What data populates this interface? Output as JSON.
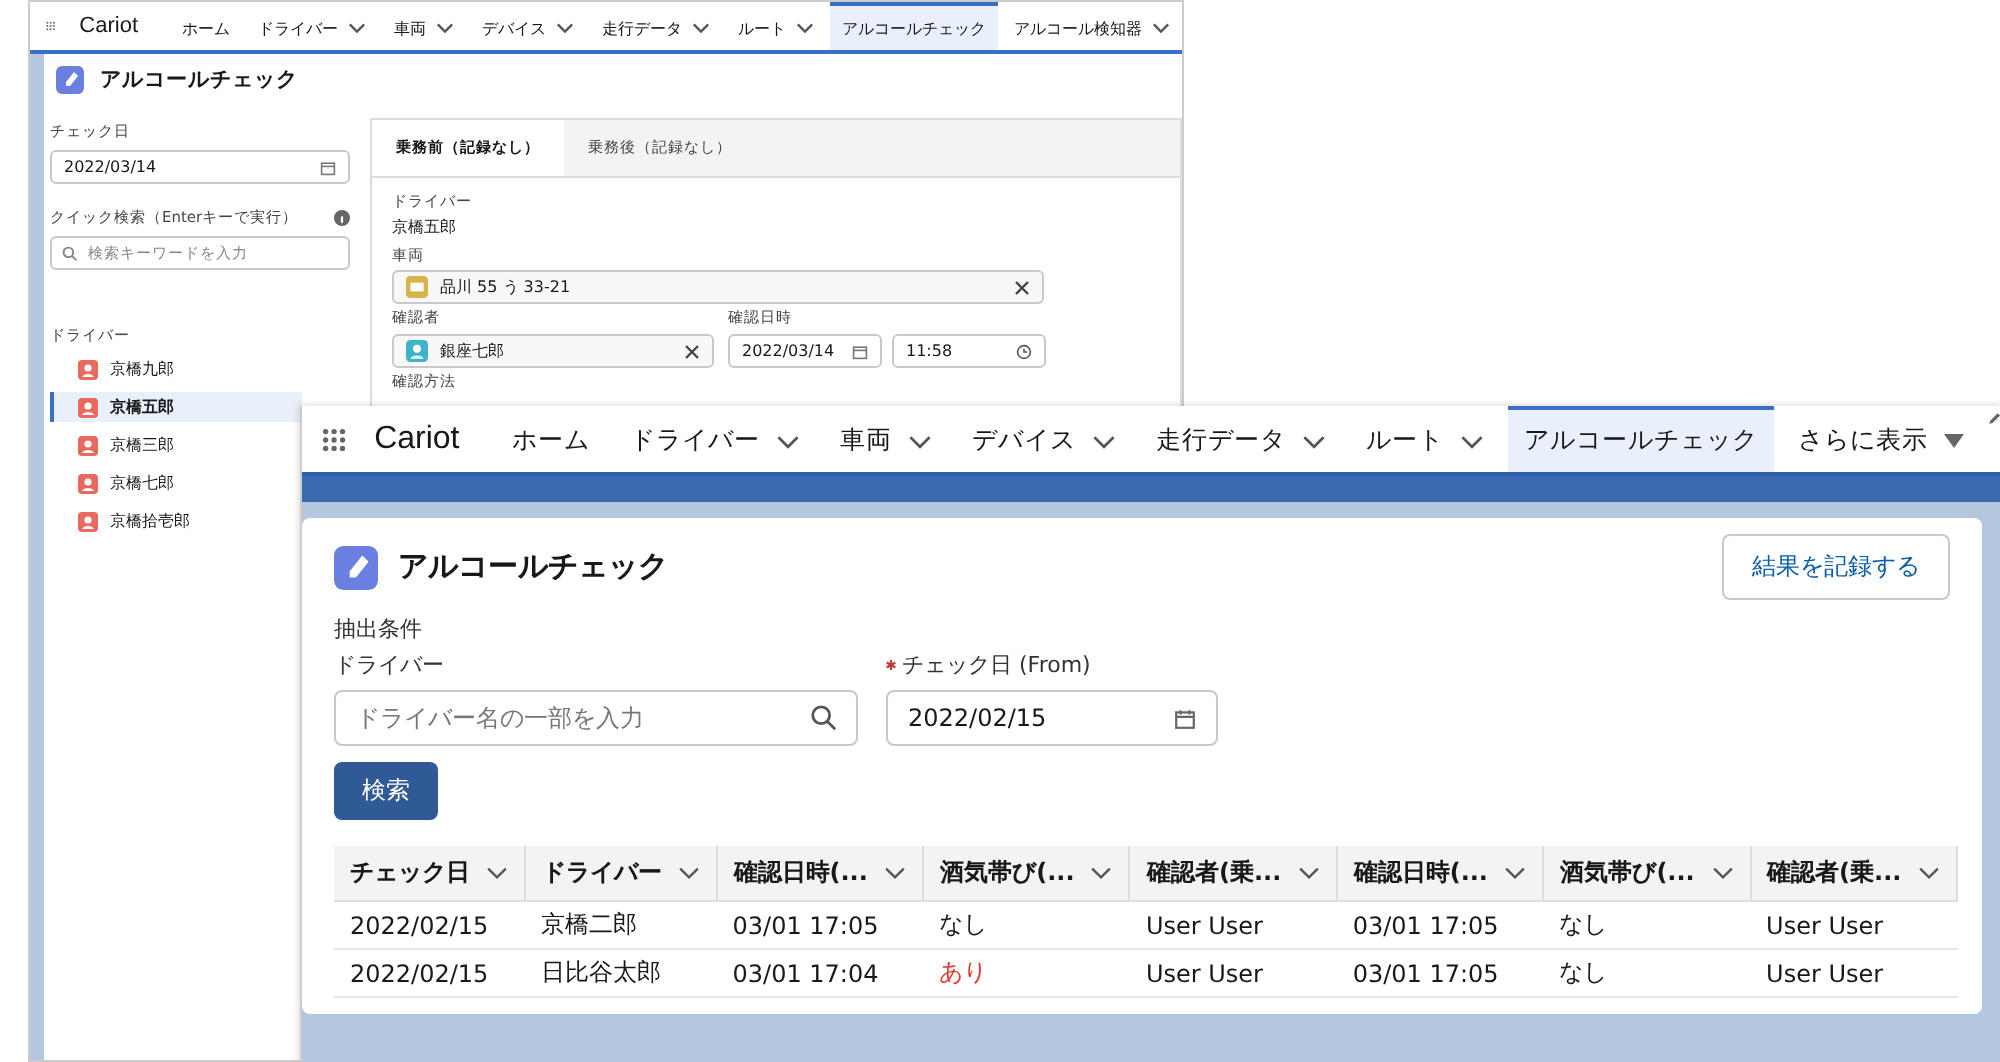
{
  "back_window": {
    "app_name": "Cariot",
    "nav": [
      {
        "label": "ホーム",
        "menu": false,
        "selected": false
      },
      {
        "label": "ドライバー",
        "menu": true,
        "selected": false
      },
      {
        "label": "車両",
        "menu": true,
        "selected": false
      },
      {
        "label": "デバイス",
        "menu": true,
        "selected": false
      },
      {
        "label": "走行データ",
        "menu": true,
        "selected": false
      },
      {
        "label": "ルート",
        "menu": true,
        "selected": false
      },
      {
        "label": "アルコールチェック",
        "menu": false,
        "selected": true
      },
      {
        "label": "アルコール検知器",
        "menu": true,
        "selected": false
      }
    ],
    "page_title": "アルコールチェック",
    "check_date": {
      "label": "チェック日",
      "value": "2022/03/14"
    },
    "quick_search": {
      "label": "クイック検索（Enterキーで実行）",
      "placeholder": "検索キーワードを入力"
    },
    "driver_list": {
      "heading": "ドライバー",
      "items": [
        {
          "name": "京橋九郎",
          "selected": false
        },
        {
          "name": "京橋五郎",
          "selected": true
        },
        {
          "name": "京橋三郎",
          "selected": false
        },
        {
          "name": "京橋七郎",
          "selected": false
        },
        {
          "name": "京橋拾壱郎",
          "selected": false
        }
      ]
    },
    "tabs": [
      {
        "label": "乗務前（記録なし）",
        "selected": true
      },
      {
        "label": "乗務後（記録なし）",
        "selected": false
      }
    ],
    "driver": {
      "label": "ドライバー",
      "value": "京橋五郎"
    },
    "vehicle": {
      "label": "車両",
      "value": "品川 55 う 33-21"
    },
    "confirmer": {
      "label": "確認者",
      "value": "銀座七郎"
    },
    "confirm_datetime": {
      "label": "確認日時",
      "date": "2022/03/14",
      "time": "11:58"
    },
    "method_label": "確認方法"
  },
  "front_window": {
    "app_name": "Cariot",
    "nav": [
      {
        "label": "ホーム",
        "menu": false,
        "selected": false
      },
      {
        "label": "ドライバー",
        "menu": true,
        "selected": false
      },
      {
        "label": "車両",
        "menu": true,
        "selected": false
      },
      {
        "label": "デバイス",
        "menu": true,
        "selected": false
      },
      {
        "label": "走行データ",
        "menu": true,
        "selected": false
      },
      {
        "label": "ルート",
        "menu": true,
        "selected": false
      },
      {
        "label": "アルコールチェック",
        "menu": false,
        "selected": true
      }
    ],
    "more": "さらに表示",
    "page_title": "アルコールチェック",
    "record_button": "結果を記録する",
    "filter_heading": "抽出条件",
    "driver_filter": {
      "label": "ドライバー",
      "placeholder": "ドライバー名の一部を入力"
    },
    "date_filter": {
      "label": "チェック日 (From)",
      "required": true,
      "value": "2022/02/15"
    },
    "search_button": "検索",
    "table": {
      "columns": [
        "チェック日",
        "ドライバー",
        "確認日時(...",
        "酒気帯び(...",
        "確認者(乗...",
        "確認日時(...",
        "酒気帯び(...",
        "確認者(乗..."
      ],
      "rows": [
        {
          "cells": [
            {
              "text": "2022/02/15",
              "alert": false
            },
            {
              "text": "京橋二郎",
              "alert": false
            },
            {
              "text": "03/01 17:05",
              "alert": false
            },
            {
              "text": "なし",
              "alert": false
            },
            {
              "text": "User User",
              "alert": false
            },
            {
              "text": "03/01 17:05",
              "alert": false
            },
            {
              "text": "なし",
              "alert": false
            },
            {
              "text": "User User",
              "alert": false
            }
          ]
        },
        {
          "cells": [
            {
              "text": "2022/02/15",
              "alert": false
            },
            {
              "text": "日比谷太郎",
              "alert": false
            },
            {
              "text": "03/01 17:04",
              "alert": false
            },
            {
              "text": "あり",
              "alert": true
            },
            {
              "text": "User User",
              "alert": false
            },
            {
              "text": "03/01 17:05",
              "alert": false
            },
            {
              "text": "なし",
              "alert": false
            },
            {
              "text": "User User",
              "alert": false
            }
          ]
        }
      ]
    }
  }
}
